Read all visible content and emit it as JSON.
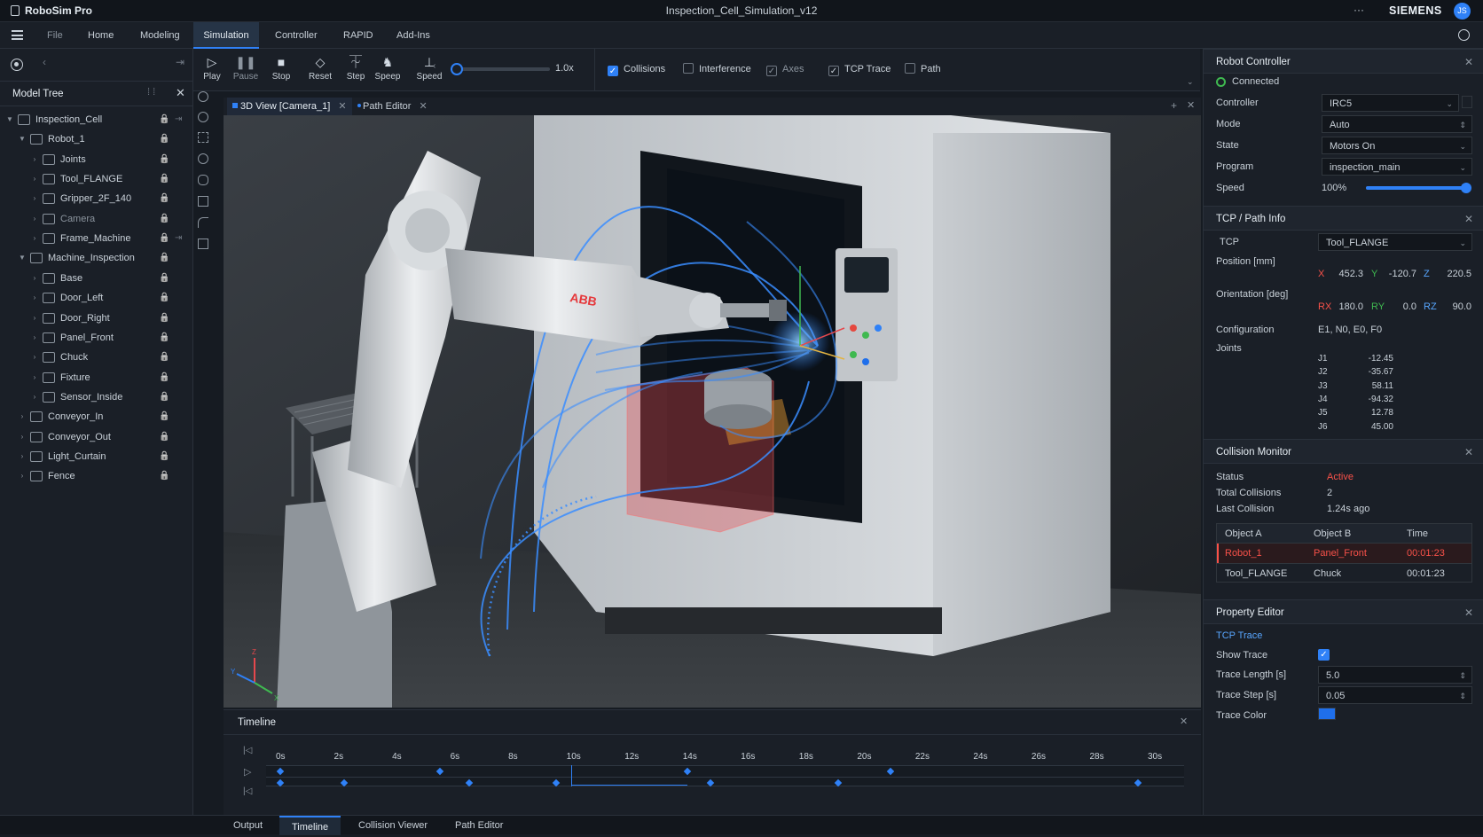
{
  "app": {
    "name": "RoboSim Pro",
    "doc_title": "Inspection_Cell_Simulation_v12",
    "brand": "SIEMENS",
    "user_initials": "JS",
    "more": "···"
  },
  "menu": [
    {
      "label": "File"
    },
    {
      "label": "Home"
    },
    {
      "label": "Modeling"
    },
    {
      "label": "Simulation"
    },
    {
      "label": "Controller"
    },
    {
      "label": "RAPID"
    },
    {
      "label": "Add-Ins"
    }
  ],
  "toolbar": {
    "play": "Play",
    "pause": "Pause",
    "stop": "Stop",
    "reset": "Reset",
    "step": "Step",
    "speed_btn": "Speep",
    "speed": "Speed",
    "speed_value": "1.0x",
    "speed_fraction": 0.06,
    "checks": [
      {
        "label": "Collisions",
        "checked": true
      },
      {
        "label": "Interference",
        "checked": false
      },
      {
        "label": "Axes",
        "checked": true
      },
      {
        "label": "TCP Trace",
        "checked": true
      },
      {
        "label": "Path",
        "checked": false
      }
    ]
  },
  "model_tree": {
    "title": "Model Tree",
    "items": [
      {
        "label": "Inspection_Cell"
      },
      {
        "label": "Robot_1"
      },
      {
        "label": "Joints"
      },
      {
        "label": "Tool_FLANGE"
      },
      {
        "label": "Gripper_2F_140"
      },
      {
        "label": "Camera"
      },
      {
        "label": "Frame_Machine"
      },
      {
        "label": "Machine_Inspection"
      },
      {
        "label": "Base"
      },
      {
        "label": "Door_Left"
      },
      {
        "label": "Door_Right"
      },
      {
        "label": "Panel_Front"
      },
      {
        "label": "Chuck"
      },
      {
        "label": "Fixture"
      },
      {
        "label": "Sensor_Inside"
      },
      {
        "label": "Conveyor_In"
      },
      {
        "label": "Conveyor_Out"
      },
      {
        "label": "Light_Curtain"
      },
      {
        "label": "Fence"
      }
    ]
  },
  "view_tabs": [
    {
      "label": "3D View [Camera_1]"
    },
    {
      "label": "Path Editor"
    }
  ],
  "viewport": {
    "logo": "ABB",
    "axis_x": "X",
    "axis_y": "Y",
    "axis_z": "Z"
  },
  "robot_controller": {
    "title": "Robot Controller",
    "status": "Connected",
    "controller_label": "Controller",
    "controller_value": "IRC5",
    "mode_label": "Mode",
    "mode_value": "Auto",
    "state_label": "State",
    "state_value": "Motors On",
    "program_label": "Program",
    "program_value": "inspection_main",
    "speed_label": "Speed",
    "speed_value": "100%",
    "speed_fraction": 1.0
  },
  "tcp": {
    "title": "TCP / Path Info",
    "tcp_label": "TCP",
    "tcp_value": "Tool_FLANGE",
    "position_label": "Position [mm]",
    "x_label": "X",
    "x": "452.3",
    "y_label": "Y",
    "y": "-120.7",
    "z_label": "Z",
    "z": "220.5",
    "orientation_label": "Orientation [deg]",
    "rx_label": "RX",
    "rx": "180.0",
    "ry_label": "RY",
    "ry": "0.0",
    "rz_label": "RZ",
    "rz": "90.0",
    "config_label": "Configuration",
    "config_value": "E1, N0, E0, F0",
    "joints_label": "Joints",
    "joints": [
      {
        "name": "J1",
        "value": "-12.45"
      },
      {
        "name": "J2",
        "value": "-35.67"
      },
      {
        "name": "J3",
        "value": "58.11"
      },
      {
        "name": "J4",
        "value": "-94.32"
      },
      {
        "name": "J5",
        "value": "12.78"
      },
      {
        "name": "J6",
        "value": "45.00"
      }
    ]
  },
  "collision": {
    "title": "Collision Monitor",
    "status_label": "Status",
    "status_value": "Active",
    "total_label": "Total Collisions",
    "total_value": "2",
    "last_label": "Last Collision",
    "last_value": "1.24s ago",
    "headers": [
      "Object A",
      "Object B",
      "Time"
    ],
    "rows": [
      {
        "a": "Robot_1",
        "b": "Panel_Front",
        "t": "00:01:23"
      },
      {
        "a": "Tool_FLANGE",
        "b": "Chuck",
        "t": "00:01:23"
      }
    ]
  },
  "property_editor": {
    "title": "Property Editor",
    "section": "TCP Trace",
    "show_trace_label": "Show Trace",
    "show_trace": true,
    "trace_length_label": "Trace Length [s]",
    "trace_length": "5.0",
    "trace_step_label": "Trace Step [s]",
    "trace_step": "0.05",
    "trace_color_label": "Trace Color",
    "trace_color": "#1f6feb"
  },
  "timeline": {
    "title": "Timeline",
    "ticks": [
      "0s",
      "2s",
      "4s",
      "6s",
      "8s",
      "10s",
      "12s",
      "14s",
      "16s",
      "18s",
      "20s",
      "22s",
      "24s",
      "26s",
      "28s",
      "30s"
    ],
    "playhead_s": 10,
    "row1_keys_s": [
      0,
      5.5,
      14,
      21
    ],
    "row2_keys_s": [
      0,
      2.2,
      6.5,
      9.5,
      14.8,
      19.2,
      29.5
    ]
  },
  "bottom_tabs": [
    {
      "label": "Output"
    },
    {
      "label": "Timeline"
    },
    {
      "label": "Collision Viewer"
    },
    {
      "label": "Path Editor"
    }
  ],
  "colors": {
    "accent": "#2f81f7",
    "danger": "#f85149",
    "ok": "#3fb950",
    "bg": "#161b22"
  }
}
